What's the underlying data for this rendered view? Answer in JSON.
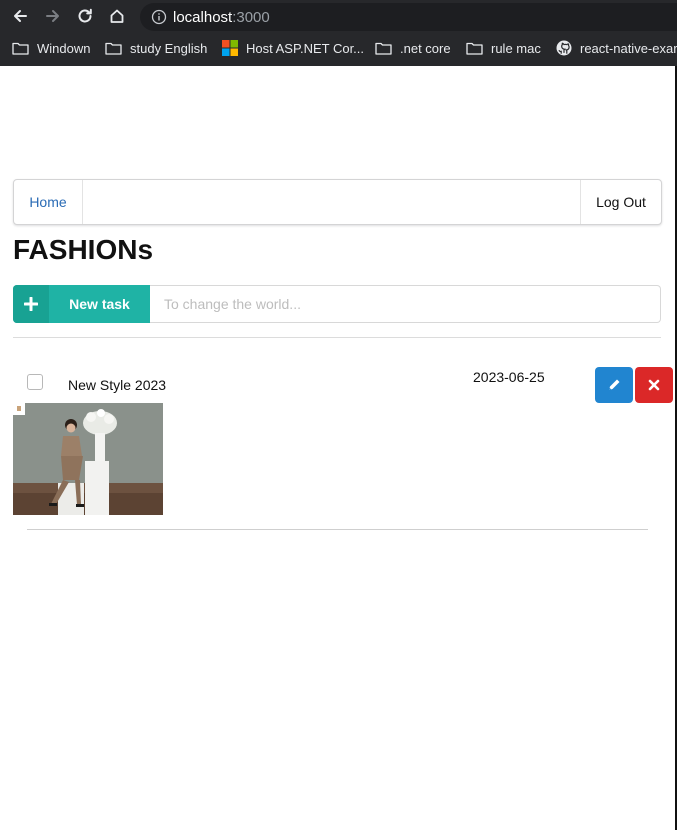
{
  "browser": {
    "url_host": "localhost",
    "url_port": ":3000",
    "bookmarks": [
      {
        "label": "Windown",
        "icon": "folder-icon"
      },
      {
        "label": "study English",
        "icon": "folder-icon"
      },
      {
        "label": "Host ASP.NET Cor...",
        "icon": "microsoft-logo-icon"
      },
      {
        "label": ".net core",
        "icon": "folder-icon"
      },
      {
        "label": "rule mac",
        "icon": "folder-icon"
      },
      {
        "label": "react-native-exar",
        "icon": "github-icon"
      }
    ]
  },
  "menu": {
    "home_label": "Home",
    "logout_label": "Log Out"
  },
  "page_title": "FASHIONs",
  "task_form": {
    "button_label": "New task",
    "button_icon": "plus-icon",
    "input_placeholder": "To change the world...",
    "input_value": ""
  },
  "tasks": [
    {
      "name": "New Style 2023",
      "date": "2023-06-25",
      "checked": false,
      "edit_icon": "pencil-icon",
      "delete_icon": "close-icon"
    }
  ],
  "colors": {
    "accent_teal": "#1fb3a5",
    "edit_blue": "#2185d0",
    "delete_red": "#db2828",
    "link_blue": "#2a6bb5",
    "chrome_dark": "#27282b"
  }
}
